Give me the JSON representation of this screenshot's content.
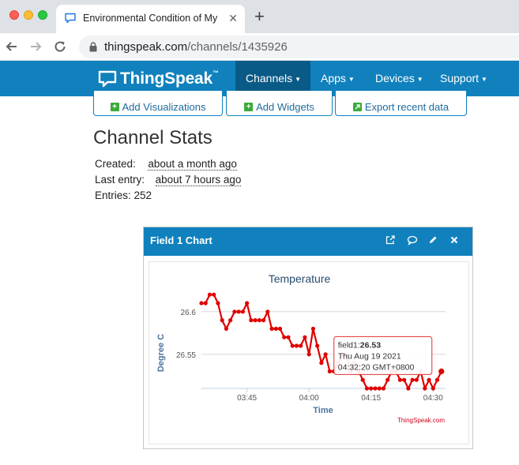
{
  "browser": {
    "tab_title": "Environmental Condition of My",
    "url_host": "thingspeak.com",
    "url_path": "/channels/1435926"
  },
  "site": {
    "logo_text": "ThingSpeak",
    "logo_tm": "™",
    "menu": [
      "Channels",
      "Apps",
      "Devices",
      "Support"
    ]
  },
  "actions": {
    "add_visualizations": "Add Visualizations",
    "add_widgets": "Add Widgets",
    "export_recent_data": "Export recent data"
  },
  "stats": {
    "title": "Channel Stats",
    "created_label": "Created:",
    "created_value": "about a month ago",
    "last_entry_label": "Last entry:",
    "last_entry_value": "about 7 hours ago",
    "entries": "Entries: 252"
  },
  "widget": {
    "title": "Field 1 Chart"
  },
  "chart_data": {
    "type": "line",
    "title": "Temperature",
    "xlabel": "Time",
    "ylabel": "Degree C",
    "credit": "ThingSpeak.com",
    "series_color": "#e00000",
    "x_ticks": [
      "03:45",
      "04:00",
      "04:15",
      "04:30"
    ],
    "y_ticks": [
      "26.55",
      "26.6"
    ],
    "xlim": [
      "03:34",
      "04:33"
    ],
    "ylim": [
      26.51,
      26.61
    ],
    "series": [
      {
        "x": [
          "03:34",
          "03:35",
          "03:36",
          "03:37",
          "03:38",
          "03:39",
          "03:40",
          "03:41",
          "03:42",
          "03:43",
          "03:44",
          "03:45",
          "03:46",
          "03:47",
          "03:48",
          "03:49",
          "03:50",
          "03:51",
          "03:52",
          "03:53",
          "03:54",
          "03:55",
          "03:56",
          "03:57",
          "03:58",
          "03:59",
          "04:00",
          "04:01",
          "04:02",
          "04:03",
          "04:04",
          "04:05",
          "04:06",
          "04:07",
          "04:08",
          "04:09",
          "04:10",
          "04:11",
          "04:12",
          "04:13",
          "04:14",
          "04:15",
          "04:16",
          "04:17",
          "04:18",
          "04:19",
          "04:20",
          "04:21",
          "04:22",
          "04:23",
          "04:24",
          "04:25",
          "04:26",
          "04:27",
          "04:28",
          "04:29",
          "04:30",
          "04:31",
          "04:32"
        ],
        "values": [
          26.61,
          26.61,
          26.62,
          26.62,
          26.61,
          26.59,
          26.58,
          26.59,
          26.6,
          26.6,
          26.6,
          26.61,
          26.59,
          26.59,
          26.59,
          26.59,
          26.6,
          26.58,
          26.58,
          26.58,
          26.57,
          26.57,
          26.56,
          26.56,
          26.56,
          26.57,
          26.55,
          26.58,
          26.56,
          26.54,
          26.55,
          26.53,
          26.53,
          26.54,
          26.55,
          26.55,
          26.53,
          26.54,
          26.53,
          26.52,
          26.51,
          26.51,
          26.51,
          26.51,
          26.51,
          26.52,
          26.53,
          26.53,
          26.52,
          26.52,
          26.51,
          26.52,
          26.52,
          26.53,
          26.51,
          26.52,
          26.51,
          26.52,
          26.53
        ]
      }
    ],
    "tooltip": {
      "field_label": "field1:",
      "value": "26.53",
      "date": "Thu Aug 19 2021",
      "time": "04:32:20 GMT+0800"
    }
  }
}
